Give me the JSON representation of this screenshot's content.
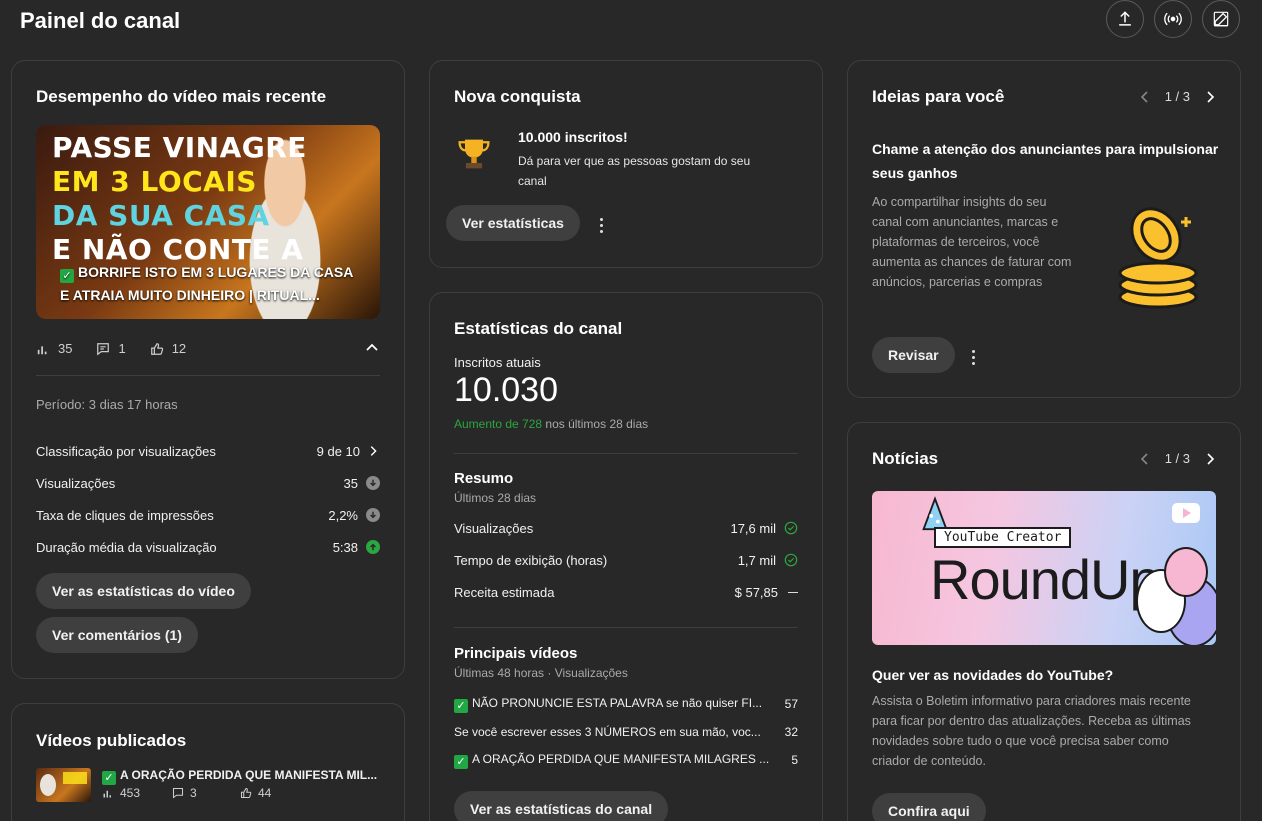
{
  "page": {
    "title": "Painel do canal"
  },
  "latest_video": {
    "heading": "Desempenho do vídeo mais recente",
    "thumb_lines": [
      "PASSE VINAGRE",
      "EM 3 LOCAIS",
      "DA SUA CASA",
      "E NÃO CONTE A"
    ],
    "title_line1": "BORRIFE ISTO EM 3 LUGARES DA CASA",
    "title_line2": "E ATRAIA MUITO DINHEIRO | RITUAL...",
    "views": "35",
    "comments": "1",
    "likes": "12",
    "period": "Período: 3 dias 17 horas",
    "metrics": [
      {
        "label": "Classificação por visualizações",
        "value": "9 de 10"
      },
      {
        "label": "Visualizações",
        "value": "35"
      },
      {
        "label": "Taxa de cliques de impressões",
        "value": "2,2%"
      },
      {
        "label": "Duração média da visualização",
        "value": "5:38"
      }
    ],
    "btn_stats": "Ver as estatísticas do vídeo",
    "btn_comments": "Ver comentários (1)"
  },
  "achievement": {
    "heading": "Nova conquista",
    "title": "10.000 inscritos!",
    "desc_line1": "Dá para ver que as pessoas gostam do seu",
    "desc_line2": "canal",
    "button": "Ver estatísticas"
  },
  "channel_stats": {
    "heading": "Estatísticas do canal",
    "subs_label": "Inscritos atuais",
    "subs_value": "10.030",
    "increase_prefix": "Aumento de 728",
    "increase_suffix": " nos últimos 28 dias",
    "summary_title": "Resumo",
    "summary_sub": "Últimos 28 dias",
    "summary": [
      {
        "label": "Visualizações",
        "value": "17,6 mil"
      },
      {
        "label": "Tempo de exibição (horas)",
        "value": "1,7 mil"
      },
      {
        "label": "Receita estimada",
        "value": "$ 57,85"
      }
    ],
    "top_title": "Principais vídeos",
    "top_sub": "Últimas 48 horas · Visualizações",
    "top_videos": [
      {
        "title": "NÃO PRONUNCIE ESTA PALAVRA se não quiser FI...",
        "views": "57"
      },
      {
        "title": "Se você escrever esses 3 NÚMEROS em sua mão, voc...",
        "views": "32"
      },
      {
        "title": "A ORAÇÃO PERDIDA QUE MANIFESTA MILAGRES ...",
        "views": "5"
      }
    ],
    "button": "Ver as estatísticas do canal"
  },
  "ideas": {
    "heading": "Ideias para você",
    "pager": "1 / 3",
    "title_line1": "Chame a atenção dos anunciantes para impulsionar",
    "title_line2": "seus ganhos",
    "desc": [
      "Ao compartilhar insights do seu",
      "canal com anunciantes, marcas e",
      "plataformas de terceiros, você",
      "aumenta as chances de faturar com",
      "anúncios, parcerias e compras"
    ],
    "button": "Revisar"
  },
  "news": {
    "heading": "Notícias",
    "pager": "1 / 3",
    "img_small": "YouTube Creator",
    "img_big": "RoundUp",
    "title": "Quer ver as novidades do YouTube?",
    "desc": [
      "Assista o Boletim informativo para criadores mais recente",
      "para ficar por dentro das atualizações. Receba as últimas",
      "novidades sobre tudo o que você precisa saber como",
      "criador de conteúdo."
    ],
    "button": "Confira aqui"
  },
  "published": {
    "heading": "Vídeos publicados",
    "video_title": "A ORAÇÃO PERDIDA QUE MANIFESTA MIL...",
    "views": "453",
    "comments": "3",
    "likes": "44"
  },
  "colors": {
    "background": "#282828",
    "card_border": "#3e3e3e",
    "accent_green": "#2ba640",
    "check_green": "#22a745"
  }
}
